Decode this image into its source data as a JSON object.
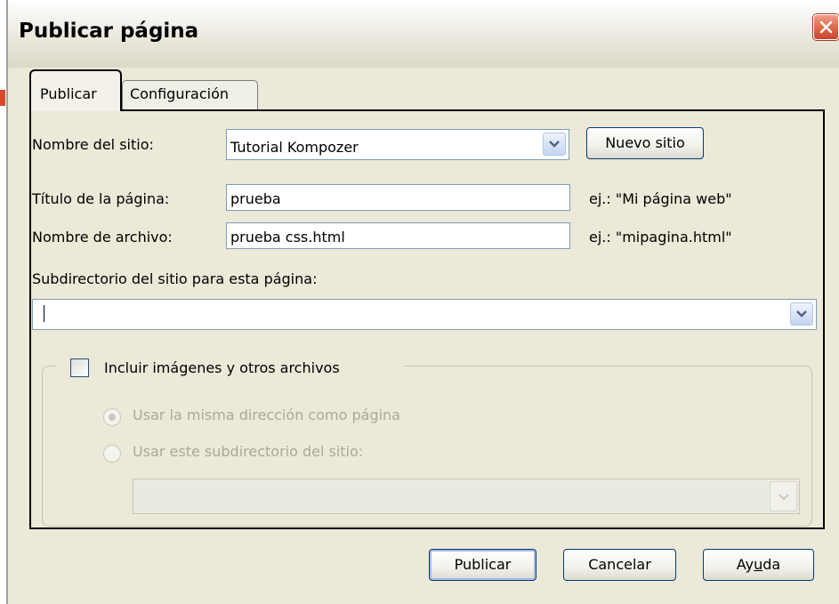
{
  "window": {
    "title": "Publicar página"
  },
  "tabs": [
    {
      "label": "Publicar",
      "active": true
    },
    {
      "label": "Configuración",
      "active": false
    }
  ],
  "site": {
    "label": "Nombre del sitio:",
    "value": "Tutorial Kompozer",
    "new_site_button": "Nuevo sitio"
  },
  "page_title": {
    "label": "Título de la página:",
    "value": "prueba",
    "hint": "ej.: \"Mi página web\""
  },
  "filename": {
    "label": "Nombre de archivo:",
    "value": "prueba css.html",
    "hint": "ej.: \"mipagina.html\""
  },
  "subdir": {
    "label": "Subdirectorio del sitio para esta página:",
    "value": ""
  },
  "include_files": {
    "label": "Incluir imágenes y otros archivos",
    "checked": false,
    "options": [
      {
        "label": "Usar la misma dirección como página",
        "selected": true,
        "enabled": false
      },
      {
        "label": "Usar este subdirectorio del sitio:",
        "selected": false,
        "enabled": false
      }
    ],
    "subdir_value": ""
  },
  "buttons": {
    "publish": "Publicar",
    "cancel": "Cancelar",
    "help_pre": "Ay",
    "help_key": "u",
    "help_post": "da"
  },
  "colors": {
    "close_button": "#e06a4c",
    "input_border": "#7f9db9",
    "dialog_bg": "#ece9d8"
  },
  "icons": {
    "close": "close-icon",
    "dropdown": "chevron-down-icon"
  }
}
